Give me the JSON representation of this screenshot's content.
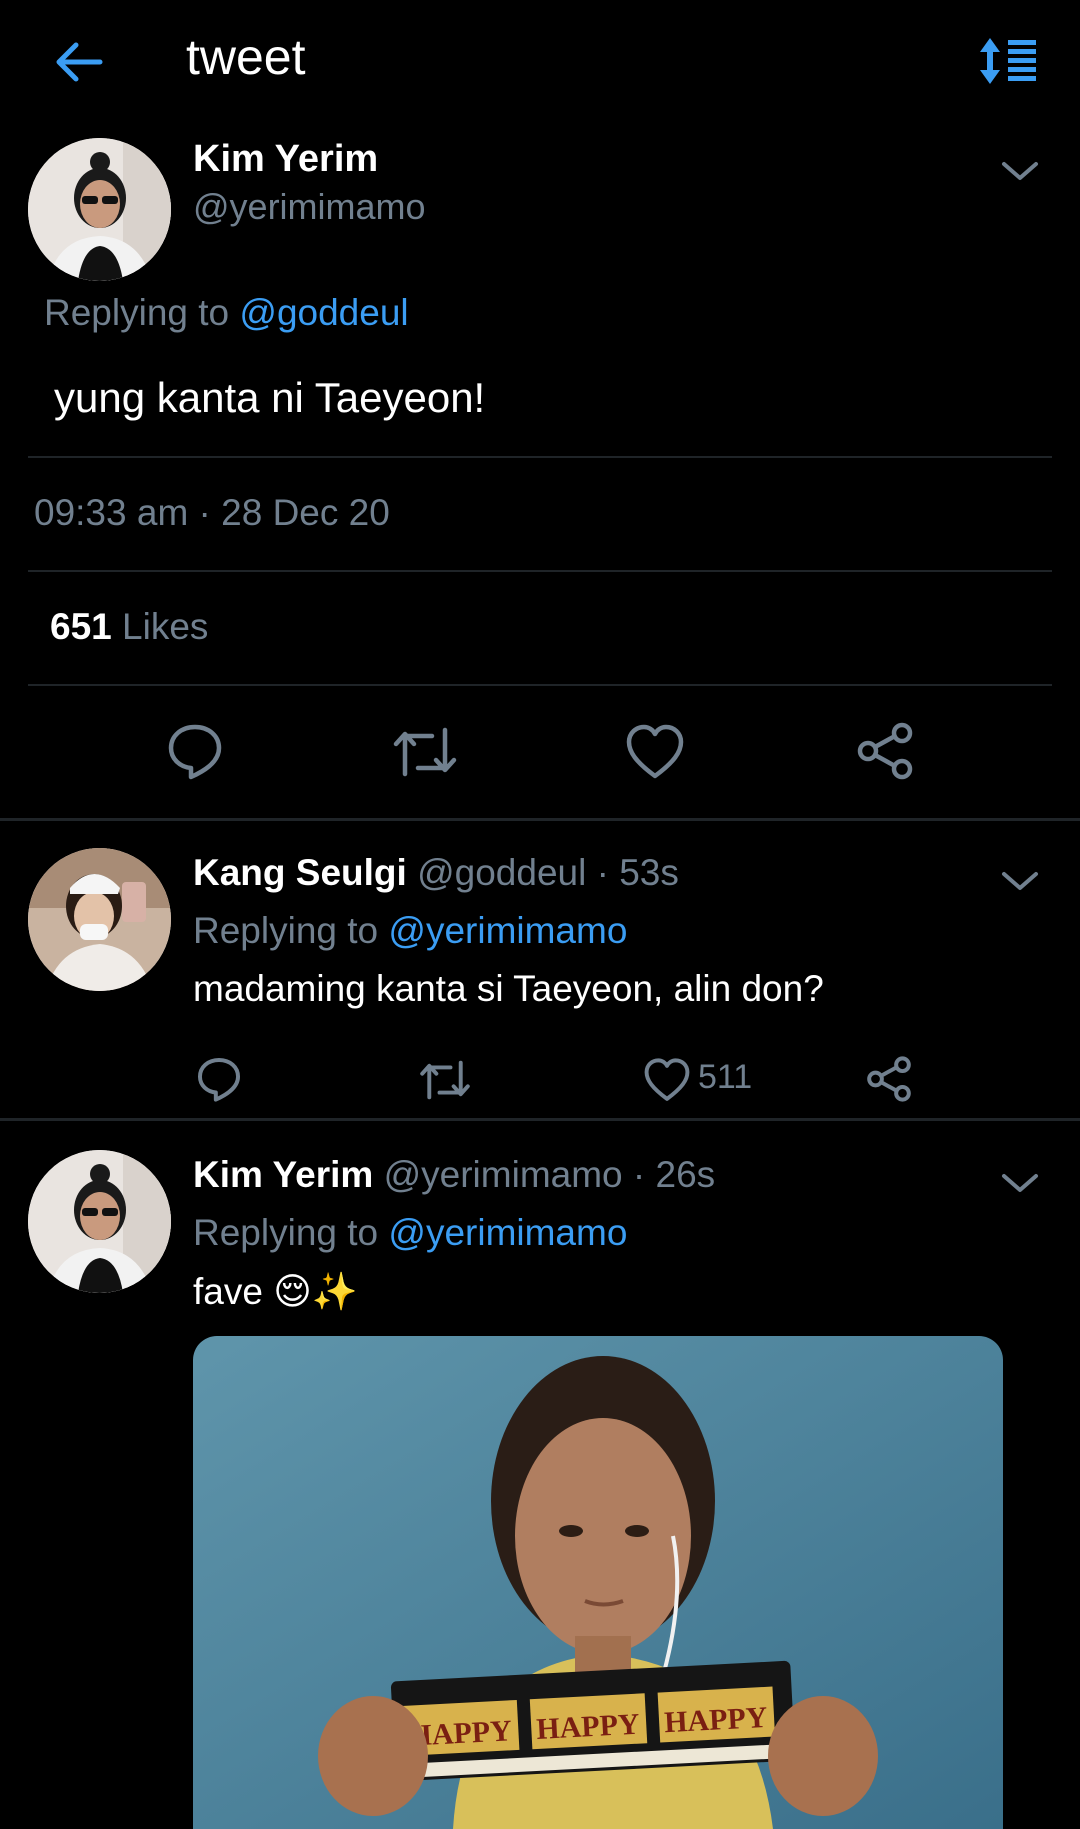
{
  "header": {
    "back_icon": "arrow-left-icon",
    "title": "tweet",
    "sort_icon": "sort-thread-icon"
  },
  "main_tweet": {
    "display_name": "Kim Yerim",
    "handle": "@yerimimamo",
    "replying_label": "Replying to",
    "replying_handle": "@goddeul",
    "text": "yung kanta ni Taeyeon!",
    "timestamp": "09:33 am · 28 Dec 20",
    "likes_count": "651",
    "likes_label": "Likes"
  },
  "replies": [
    {
      "display_name": "Kang Seulgi",
      "handle": "@goddeul",
      "time": "· 53s",
      "replying_label": "Replying to",
      "replying_handle": "@yerimimamo",
      "text": "madaming kanta si Taeyeon, alin don?",
      "like_count": "511"
    },
    {
      "display_name": "Kim Yerim",
      "handle": "@yerimimamo",
      "time": "· 26s",
      "replying_label": "Replying to",
      "replying_handle": "@yerimimamo",
      "text": "fave 😌✨",
      "media_text": "HAPPY"
    }
  ],
  "colors": {
    "background": "#000000",
    "accent": "#3b9df3",
    "muted": "#71808f",
    "divider": "#1f2428"
  }
}
